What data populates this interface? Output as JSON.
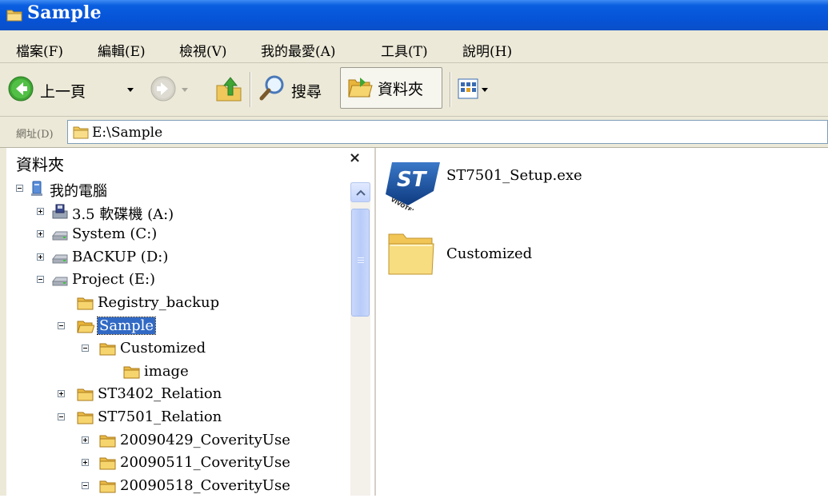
{
  "window": {
    "title": "Sample"
  },
  "menu": [
    {
      "label": "檔案(F)"
    },
    {
      "label": "編輯(E)"
    },
    {
      "label": "檢視(V)"
    },
    {
      "label": "我的最愛(A)"
    },
    {
      "label": "工具(T)"
    },
    {
      "label": "說明(H)"
    }
  ],
  "toolbar": {
    "back_label": "上一頁",
    "search_label": "搜尋",
    "folders_label": "資料夾"
  },
  "address": {
    "label": "網址(D)",
    "value": "E:\\Sample"
  },
  "folders_pane": {
    "title": "資料夾",
    "close": "×",
    "tree": [
      {
        "label": "我的電腦",
        "icon": "my-computer-icon",
        "toggle": "minus"
      },
      {
        "label": "3.5 軟碟機 (A:)",
        "icon": "floppy-drive-icon",
        "toggle": "plus"
      },
      {
        "label": "System (C:)",
        "icon": "hard-drive-icon",
        "toggle": "plus"
      },
      {
        "label": "BACKUP (D:)",
        "icon": "hard-drive-icon",
        "toggle": "plus"
      },
      {
        "label": "Project (E:)",
        "icon": "hard-drive-icon",
        "toggle": "minus"
      },
      {
        "label": "Registry_backup",
        "icon": "folder-icon",
        "toggle": "none"
      },
      {
        "label": "Sample",
        "icon": "open-folder-icon",
        "toggle": "minus",
        "selected": true
      },
      {
        "label": "Customized",
        "icon": "folder-icon",
        "toggle": "minus"
      },
      {
        "label": "image",
        "icon": "folder-icon",
        "toggle": "none"
      },
      {
        "label": "ST3402_Relation",
        "icon": "folder-icon",
        "toggle": "plus"
      },
      {
        "label": "ST7501_Relation",
        "icon": "folder-icon",
        "toggle": "minus"
      },
      {
        "label": "20090429_CoverityUse",
        "icon": "folder-icon",
        "toggle": "plus"
      },
      {
        "label": "20090511_CoverityUse",
        "icon": "folder-icon",
        "toggle": "plus"
      },
      {
        "label": "20090518_CoverityUse",
        "icon": "folder-icon",
        "toggle": "minus"
      }
    ]
  },
  "files": [
    {
      "name": "ST7501_Setup.exe",
      "icon": "st-setup-exe-icon",
      "logo_text": "ST",
      "logo_brand": "VIVOTEK"
    },
    {
      "name": "Customized",
      "icon": "large-folder-icon"
    }
  ],
  "colors": {
    "titlebar": "#0654d8",
    "chrome": "#ece9d8",
    "selection": "#316ac5",
    "folder": "#f5d56b"
  }
}
